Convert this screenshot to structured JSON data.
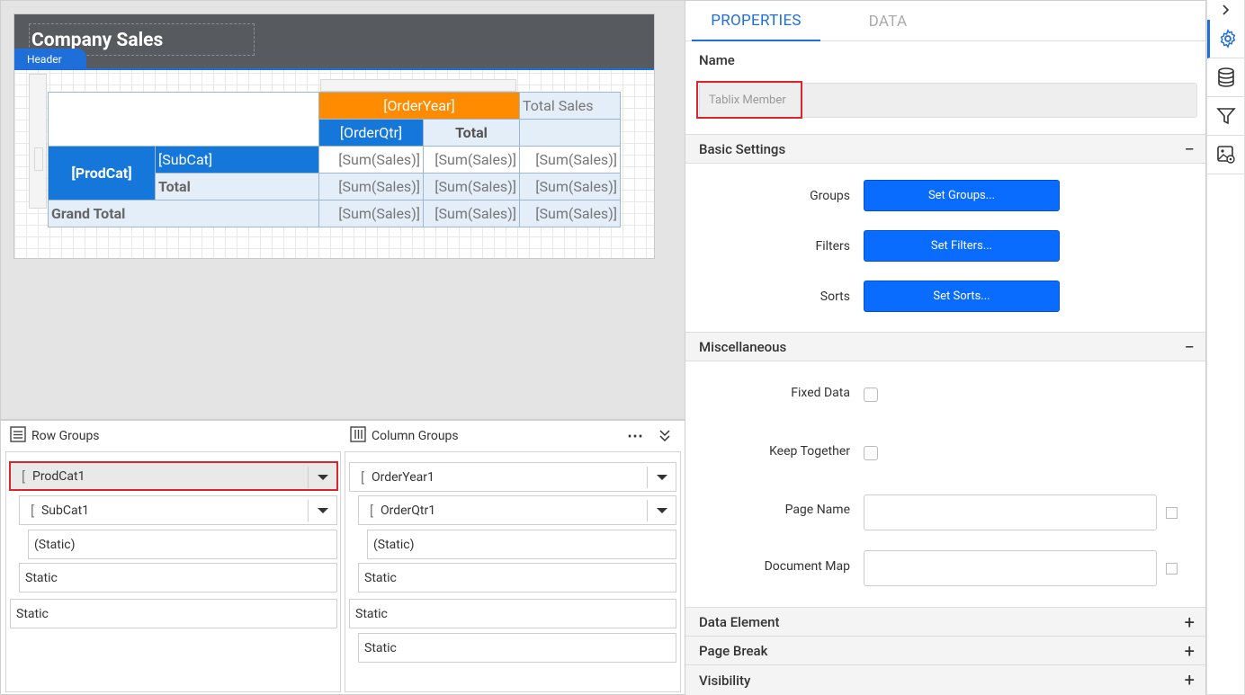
{
  "report": {
    "title": "Company Sales",
    "header_tag": "Header"
  },
  "tablix": {
    "order_year": "[OrderYear]",
    "total_sales": "Total Sales",
    "order_qtr": "[OrderQtr]",
    "total": "Total",
    "prod_cat": "[ProdCat]",
    "sub_cat": "[SubCat]",
    "sum_sales": "[Sum(Sales)]",
    "grand_total": "Grand Total"
  },
  "row_groups": {
    "title": "Row Groups",
    "items": [
      "ProdCat1",
      "SubCat1",
      "(Static)",
      "Static",
      "Static"
    ]
  },
  "column_groups": {
    "title": "Column Groups",
    "items": [
      "OrderYear1",
      "OrderQtr1",
      "(Static)",
      "Static",
      "Static",
      "Static"
    ]
  },
  "properties": {
    "tabs": [
      "PROPERTIES",
      "DATA"
    ],
    "name_label": "Name",
    "name_value": "Tablix Member",
    "basic_settings": "Basic Settings",
    "groups_label": "Groups",
    "groups_btn": "Set Groups...",
    "filters_label": "Filters",
    "filters_btn": "Set Filters...",
    "sorts_label": "Sorts",
    "sorts_btn": "Set Sorts...",
    "misc": "Miscellaneous",
    "fixed_data": "Fixed Data",
    "keep_together": "Keep Together",
    "page_name": "Page Name",
    "document_map": "Document Map",
    "data_element": "Data Element",
    "page_break": "Page Break",
    "visibility": "Visibility",
    "minus": "−",
    "plus": "+"
  },
  "colors": {
    "accent": "#1e6fd9",
    "orange": "#ff8c00",
    "button": "#0a6cff",
    "selected_border": "#d9252b"
  }
}
